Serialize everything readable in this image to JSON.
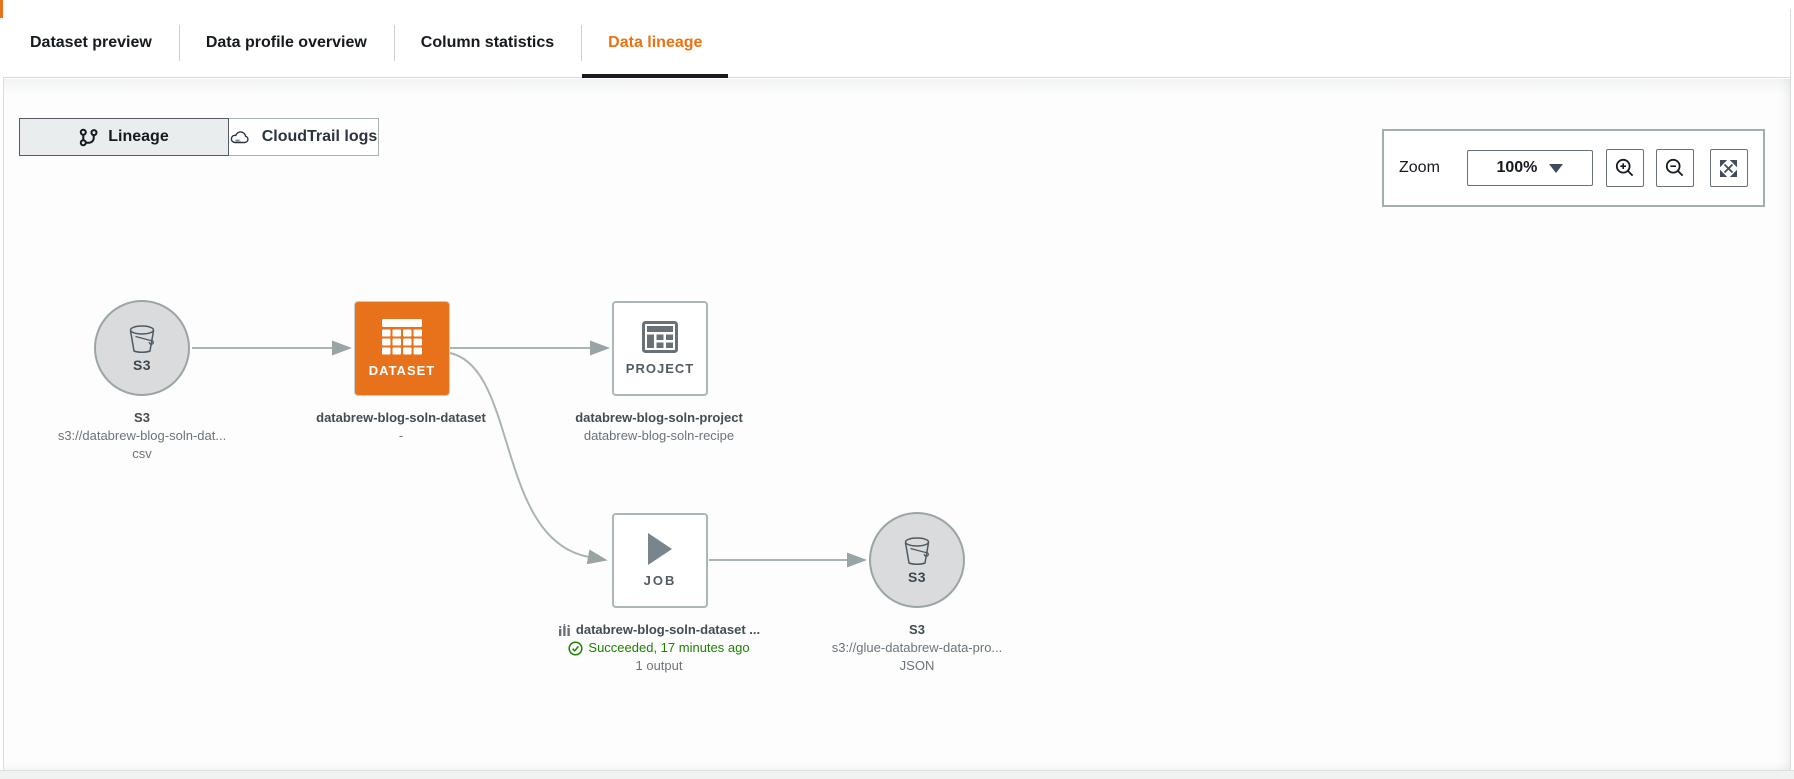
{
  "tabs": {
    "items": [
      {
        "label": "Dataset preview",
        "active": false
      },
      {
        "label": "Data profile overview",
        "active": false
      },
      {
        "label": "Column statistics",
        "active": false
      },
      {
        "label": "Data lineage",
        "active": true
      }
    ]
  },
  "view_toggle": {
    "lineage_label": "Lineage",
    "cloudtrail_label": "CloudTrail logs"
  },
  "zoom_controls": {
    "label": "Zoom",
    "level": "100%"
  },
  "diagram": {
    "nodes": {
      "source_s3": {
        "kind": "S3",
        "inner_label": "S3",
        "title": "S3",
        "subtitle": "s3://databrew-blog-soln-dat...",
        "format": "csv"
      },
      "dataset": {
        "type_label": "DATASET",
        "title": "databrew-blog-soln-dataset",
        "subtitle": "-"
      },
      "project": {
        "type_label": "PROJECT",
        "title": "databrew-blog-soln-project",
        "subtitle": "databrew-blog-soln-recipe"
      },
      "job": {
        "type_label": "JOB",
        "title": "databrew-blog-soln-dataset ...",
        "status": "Succeeded, 17 minutes ago",
        "outputs": "1 output"
      },
      "target_s3": {
        "kind": "S3",
        "inner_label": "S3",
        "title": "S3",
        "subtitle": "s3://glue-databrew-data-pro...",
        "format": "JSON"
      }
    },
    "edges": [
      "source_s3 -> dataset",
      "dataset -> project",
      "dataset -> job",
      "job -> target_s3"
    ]
  },
  "icons": {
    "lineage-icon": "branch-graph glyph",
    "cloudtrail-icon": "cloud outline",
    "caret-down-icon": "▼",
    "zoom-in-icon": "magnifier with plus",
    "zoom-out-icon": "magnifier with minus",
    "fullscreen-icon": "four outward arrows",
    "s3-bucket-icon": "bucket outline",
    "dataset-grid-icon": "white table grid",
    "project-table-icon": "gray table grid",
    "job-play-icon": "play triangle",
    "job-chart-icon": "mini bar chart",
    "success-check-icon": "check in circle"
  },
  "colors": {
    "accent_orange": "#e8721c",
    "active_tab_text": "#ec7211",
    "active_tab_underline": "#16191f",
    "success_green": "#1d8102",
    "edge_gray": "#a9b4b4",
    "node_border_gray": "#aab7b8",
    "s3_fill": "#dadbdc"
  }
}
